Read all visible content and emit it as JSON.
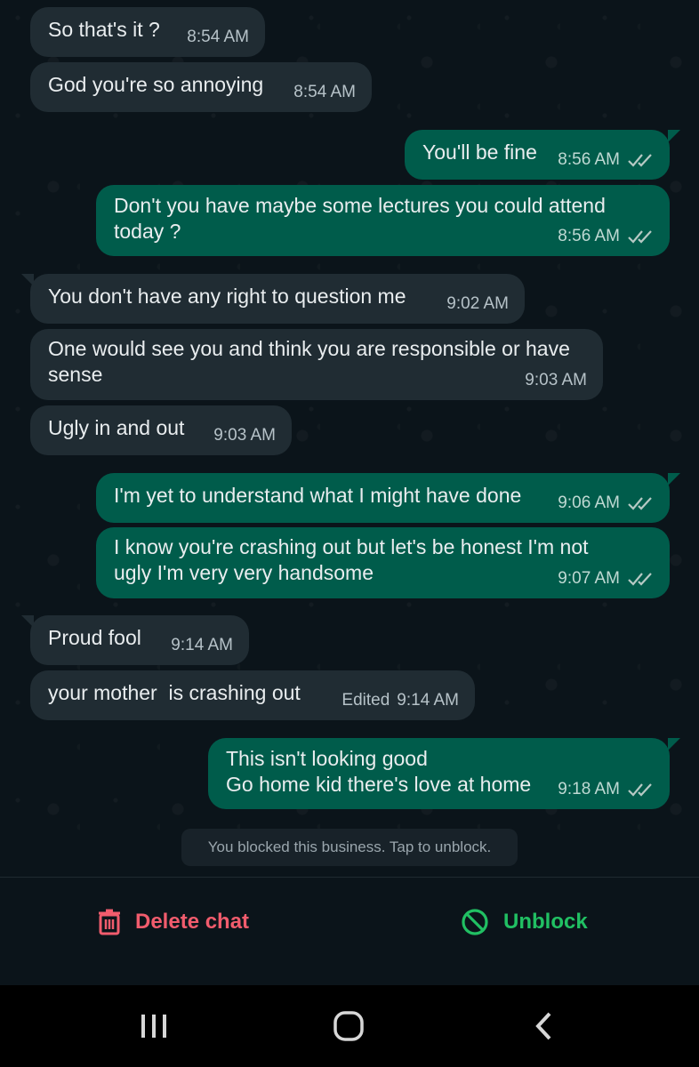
{
  "messages": [
    {
      "text": "So that's it ?",
      "time": "8:54 AM"
    },
    {
      "text": "God you're so annoying",
      "time": "8:54 AM"
    },
    {
      "text": "You'll be fine",
      "time": "8:56 AM"
    },
    {
      "text": "Don't you have maybe some lectures you could attend\ntoday ?",
      "time": "8:56 AM"
    },
    {
      "text": "You don't have any right to question me",
      "time": "9:02 AM"
    },
    {
      "text": "One would see you and think you are responsible or have\nsense",
      "time": "9:03 AM"
    },
    {
      "text": "Ugly in and out",
      "time": "9:03 AM"
    },
    {
      "text": "I'm yet to understand what I might have done",
      "time": "9:06 AM"
    },
    {
      "text": "I know you're crashing out but let's be honest I'm not\nugly I'm very very handsome",
      "time": "9:07 AM"
    },
    {
      "text": "Proud fool",
      "time": "9:14 AM"
    },
    {
      "text": "your mother  is crashing out",
      "time": "9:14 AM",
      "edited": "Edited"
    },
    {
      "text": "This isn't looking good\nGo home kid there's love at home",
      "time": "9:18 AM"
    }
  ],
  "system_note": "You blocked this business. Tap to unblock.",
  "actions": {
    "delete_label": "Delete chat",
    "unblock_label": "Unblock"
  },
  "colors": {
    "incoming": "#202c33",
    "outgoing": "#005c4b",
    "delete": "#f15c6d",
    "unblock": "#21c063"
  }
}
